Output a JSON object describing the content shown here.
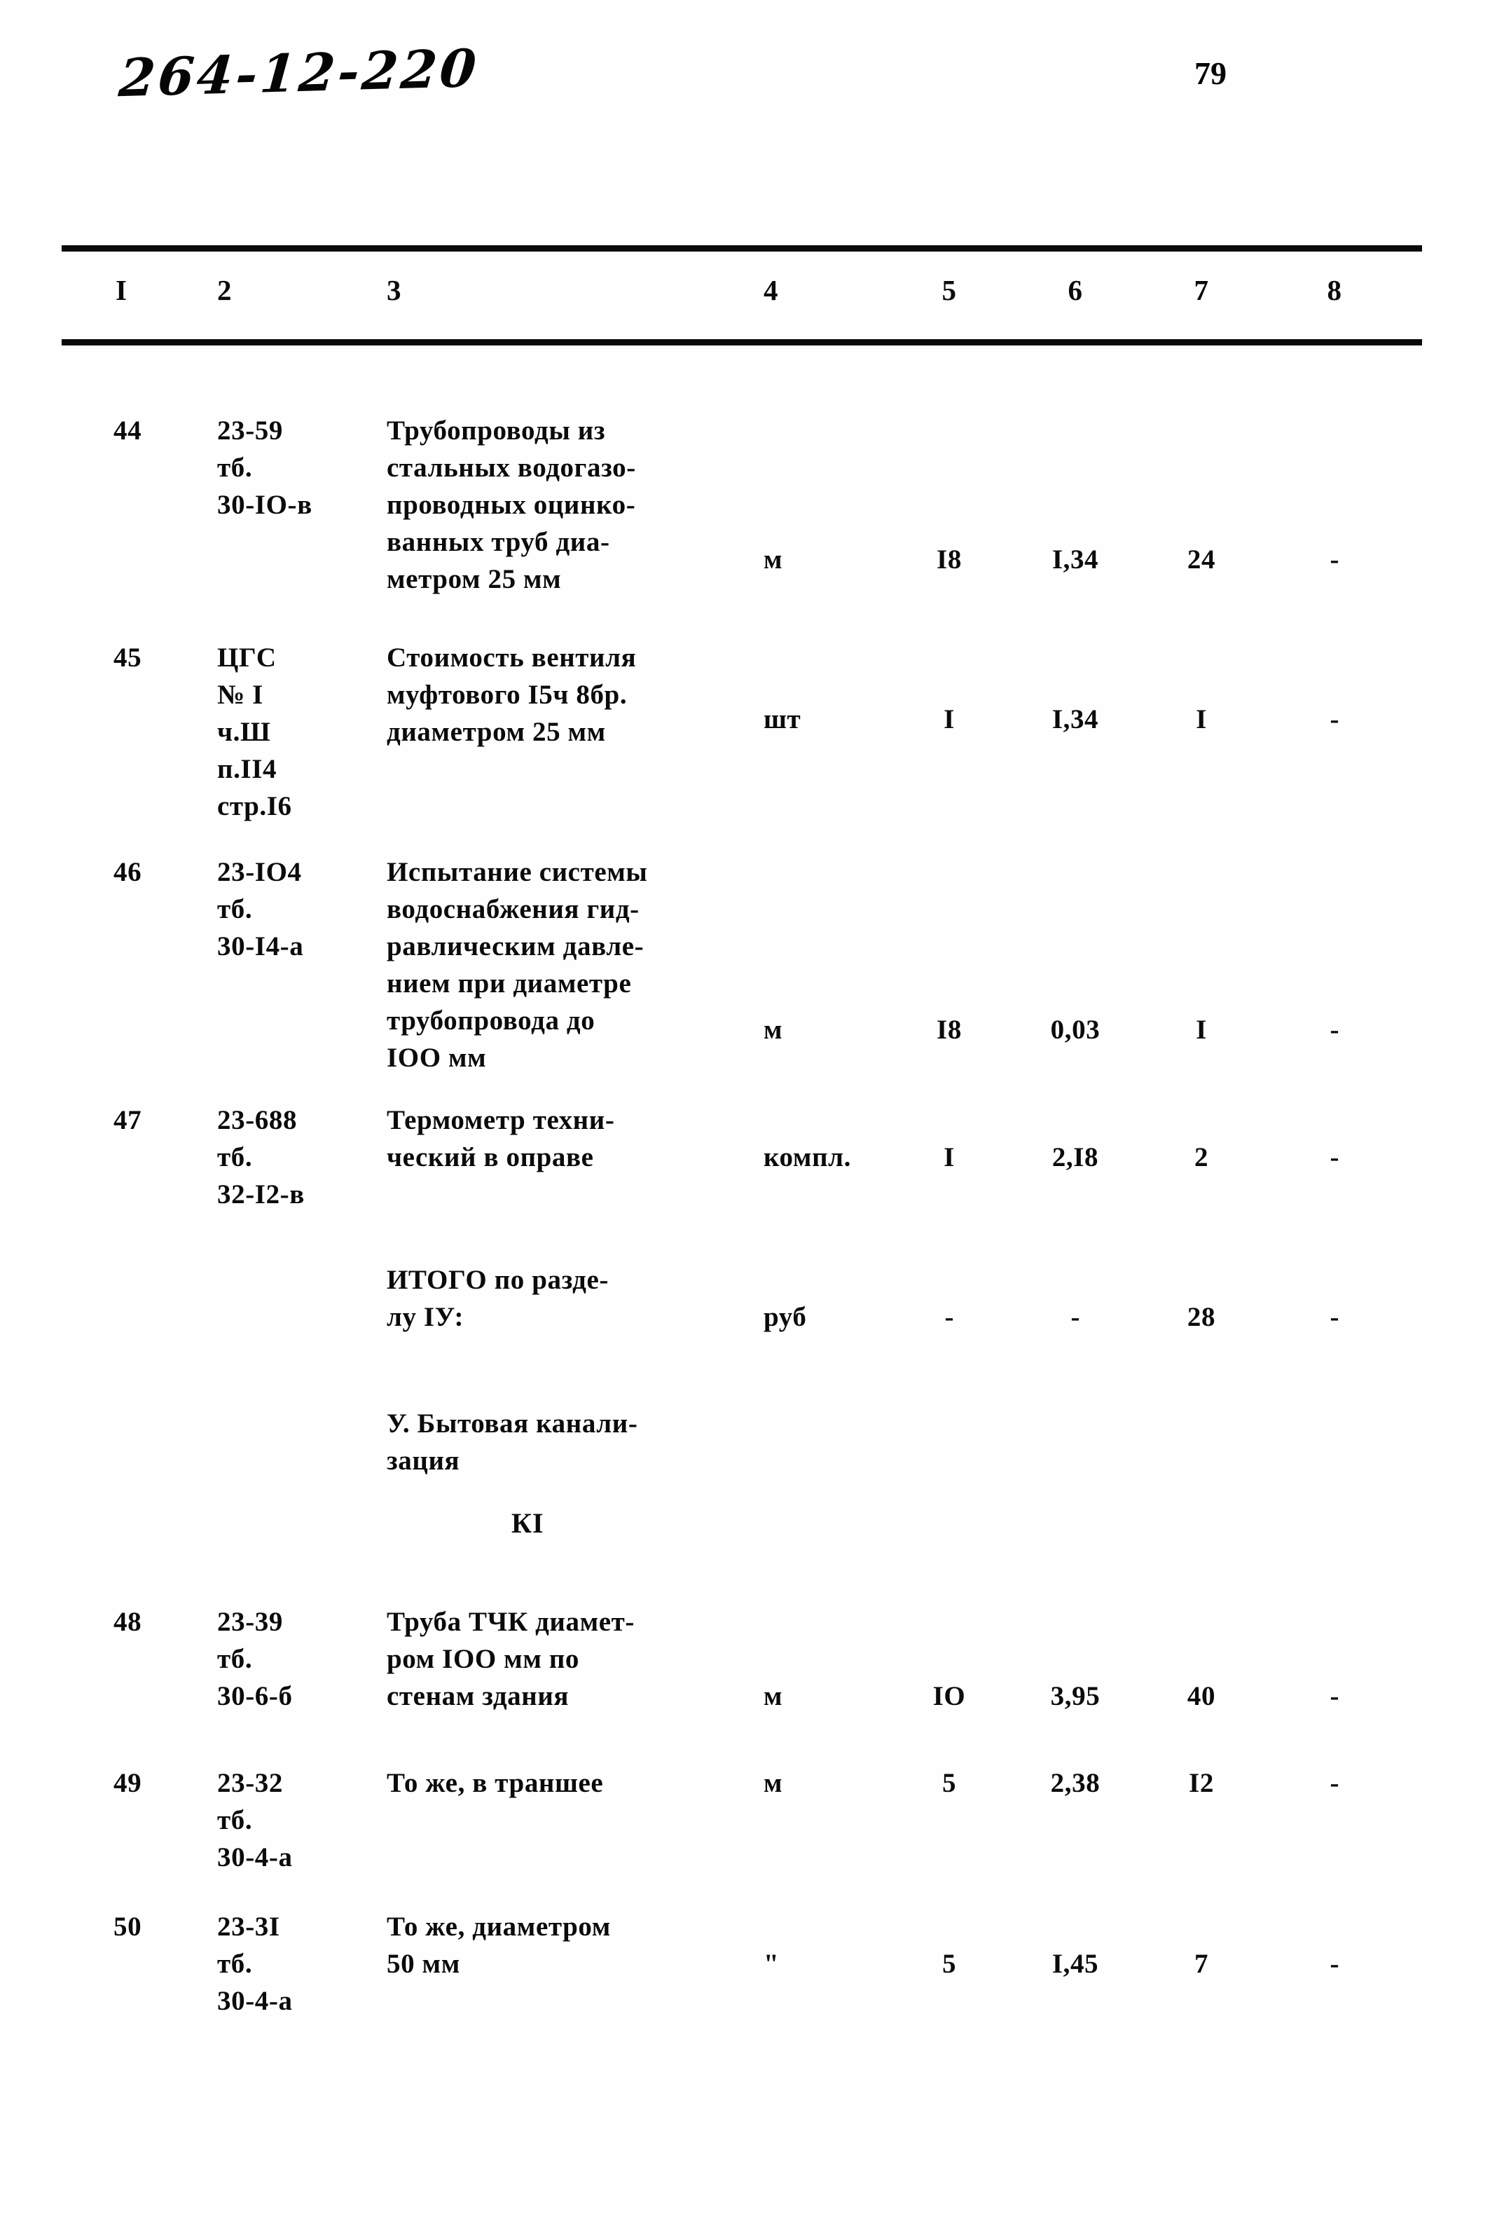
{
  "document": {
    "code_handwritten": "264-12-220",
    "page_number": "79"
  },
  "table": {
    "column_headers": [
      "I",
      "2",
      "3",
      "4",
      "5",
      "6",
      "7",
      "8"
    ],
    "rows": [
      {
        "no": "44",
        "code": "23-59\nтб.\n30-IО-в",
        "description": "Трубопроводы из\nстальных водогазо-\nпроводных оцинко-\nванных труб диа-\nметром 25 мм",
        "unit": "м",
        "qty": "I8",
        "price": "I,34",
        "total": "24",
        "extra": "-"
      },
      {
        "no": "45",
        "code": "ЦГС\n№ I\nч.Ш\nп.II4\nстр.I6",
        "description": "Стоимость вентиля\nмуфтового I5ч 8бр.\nдиаметром 25 мм",
        "unit": "шт",
        "qty": "I",
        "price": "I,34",
        "total": "I",
        "extra": "-"
      },
      {
        "no": "46",
        "code": "23-IО4\nтб.\n30-I4-а",
        "description": "Испытание системы\nводоснабжения гид-\nравлическим давле-\nнием при диаметре\nтрубопровода  до\nIОО мм",
        "unit": "м",
        "qty": "I8",
        "price": "0,03",
        "total": "I",
        "extra": "-"
      },
      {
        "no": "47",
        "code": "23-688\nтб.\n32-I2-в",
        "description": "Термометр техни-\nческий в оправе",
        "unit": "компл.",
        "qty": "I",
        "price": "2,I8",
        "total": "2",
        "extra": "-"
      }
    ],
    "subtotal": {
      "label": "ИТОГО по разде-\nлу IУ:",
      "unit": "руб",
      "qty": "-",
      "price": "-",
      "total": "28",
      "extra": "-"
    },
    "section": {
      "title": "У. Бытовая канали-\nзация",
      "mark": "КI"
    },
    "rows2": [
      {
        "no": "48",
        "code": "23-39\nтб.\n30-6-б",
        "description": "Труба ТЧК диамет-\nром IОО мм по\nстенам здания",
        "unit": "м",
        "qty": "IО",
        "price": "3,95",
        "total": "40",
        "extra": "-"
      },
      {
        "no": "49",
        "code": "23-32\nтб.\n30-4-а",
        "description": "То же, в траншее",
        "unit": "м",
        "qty": "5",
        "price": "2,38",
        "total": "I2",
        "extra": "-"
      },
      {
        "no": "50",
        "code": "23-3I\nтб.\n30-4-а",
        "description": "То же, диаметром\n50 мм",
        "unit": "\"",
        "qty": "5",
        "price": "I,45",
        "total": "7",
        "extra": "-"
      }
    ]
  }
}
